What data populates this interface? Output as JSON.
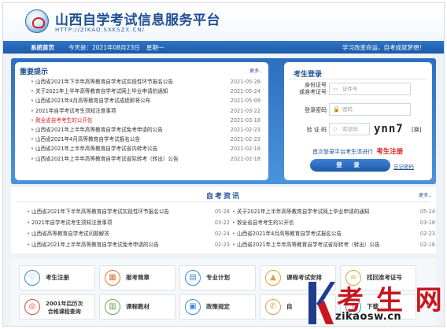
{
  "header": {
    "title": "山西自学考试信息服务平台",
    "url_text": "HTTP://ZIKAO.SXKSZX.CN/"
  },
  "nav": {
    "home": "系统首页",
    "date": "今天是：2021年08月23日",
    "weekday": "星期一",
    "slogan": "学习改变命运，自考成就梦想！"
  },
  "notices": {
    "title": "重要提示",
    "more": "更多..",
    "items": [
      {
        "title": "山西省2021年下半年高等教育自学考试实践性环节报名公告",
        "date": "2021-05-28",
        "red": false
      },
      {
        "title": "关于2021年上半年高等教育自学考试网上毕业申请的通知",
        "date": "2021-05-24",
        "red": false
      },
      {
        "title": "山西省2021年4月高等教育自学考试成绩即将公布",
        "date": "2021-05-09",
        "red": false
      },
      {
        "title": "2021年自学考试考生须知注意事项",
        "date": "2021-03-22",
        "red": false
      },
      {
        "title": "致全省自考考生的公开信",
        "date": "2021-03-18",
        "red": true
      },
      {
        "title": "山西省2021年上半年高等教育自学考试免考申请的公告",
        "date": "2021-02-23",
        "red": false
      },
      {
        "title": "山西省2021年4月高等教育自学考试报名公告",
        "date": "2021-02-23",
        "red": false
      },
      {
        "title": "山西省2021年上半年高等教育自学考试省内转考公告",
        "date": "2021-02-18",
        "red": false
      },
      {
        "title": "山西省2021年上半年高等教育自学考试省际转考（转出）公告",
        "date": "2021-02-18",
        "red": false
      }
    ]
  },
  "login": {
    "title": "考生登录",
    "id_label": "身份证号\n或准考证号",
    "id_placeholder": "证件号",
    "pwd_label": "登录密码",
    "pwd_placeholder": "密码",
    "captcha_label": "验 证 码",
    "captcha_placeholder": "验证码",
    "captcha_text": "ynn7",
    "captcha_refresh": "[换]",
    "first_login": "首次登录平台考生须进行",
    "register": "考生注册",
    "login_button": "登 录",
    "forgot": "忘记密码"
  },
  "news": {
    "title": "自考资讯",
    "more": "更多..",
    "left": [
      {
        "title": "山西省2021年下半年高等教育自学考试实践性环节报名公告",
        "date": "05-28"
      },
      {
        "title": "2021年自学考试考生须知注意事项",
        "date": "03-22"
      },
      {
        "title": "山西省高等教育自学考试问题解答",
        "date": "02-24"
      },
      {
        "title": "山西省2021年上半年高等教育自学考试免考申请的公告",
        "date": "02-23"
      }
    ],
    "right": [
      {
        "title": "关于2021年上半年高等教育自学考试网上毕业申请的通知",
        "date": "05-24"
      },
      {
        "title": "致全省自考考生的公开信",
        "date": "03-18"
      },
      {
        "title": "山西省2021年4月高等教育自学考试报名公告",
        "date": "02-23"
      },
      {
        "title": "山西省2021年上半年高等教育自学考试省际转考（转出）公告",
        "date": "02-18"
      }
    ]
  },
  "quick_links": [
    {
      "label": "考生注册",
      "icon": "heart-icon",
      "glyph": "♡",
      "color": "#3a8be0"
    },
    {
      "label": "报考简章",
      "icon": "calendar-icon",
      "glyph": "▦",
      "color": "#e0773a"
    },
    {
      "label": "专业计划",
      "icon": "book-icon",
      "glyph": "▤",
      "color": "#3a8be0"
    },
    {
      "label": "课程考试安排",
      "icon": "graduation-cap-icon",
      "glyph": "▲",
      "color": "#e0a23a"
    },
    {
      "label": "找回准考证号",
      "icon": "link-icon",
      "glyph": "∞",
      "color": "#e0a23a"
    },
    {
      "label": "2001年后历次\n合格课程查询",
      "icon": "badge-icon",
      "glyph": "◎",
      "color": "#d94a4a"
    },
    {
      "label": "课程教材",
      "icon": "books-icon",
      "glyph": "▥",
      "color": "#6aa84f"
    },
    {
      "label": "政策规定",
      "icon": "document-icon",
      "glyph": "▣",
      "color": "#3a8be0"
    },
    {
      "label": "自",
      "icon": "phone-icon",
      "glyph": "✆",
      "color": "#e0a23a"
    },
    {
      "label": "下载",
      "icon": "download-icon",
      "glyph": "⇩",
      "color": "#3a8be0"
    }
  ],
  "watermark": {
    "brand": "考 生 网",
    "url": "zikaosw.cn",
    "colors": {
      "k_blue": "#1f3d8c",
      "red": "#c9161d"
    }
  }
}
